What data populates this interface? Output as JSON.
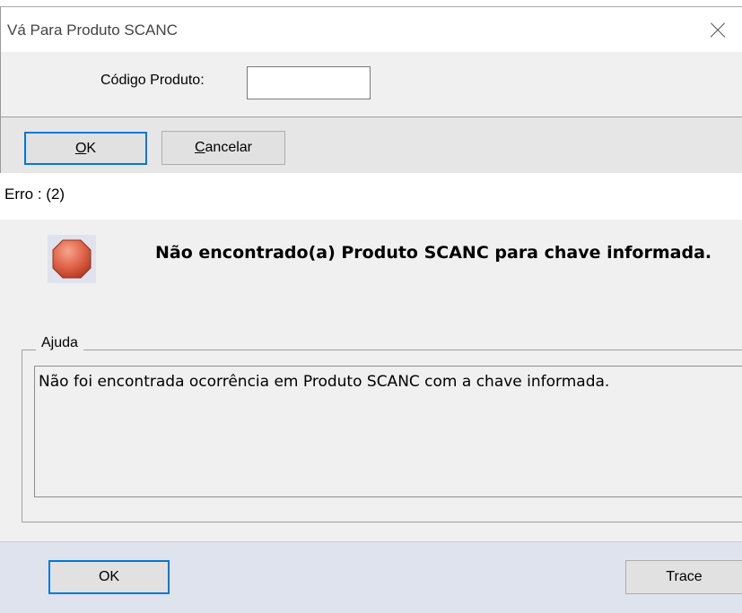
{
  "top_dialog": {
    "title": "Vá Para Produto SCANC",
    "code_label": "Código Produto:",
    "code_value": "",
    "ok_label": "OK",
    "cancel_label": "Cancelar",
    "close_icon": "close-icon"
  },
  "error_dialog": {
    "title": "Erro : (2)",
    "icon": "stop-icon",
    "message": "Não encontrado(a) Produto SCANC para chave informada.",
    "help_legend": "Ajuda",
    "help_text": "Não foi encontrada ocorrência em Produto SCANC com a chave informada.",
    "ok_label": "OK",
    "trace_label": "Trace"
  },
  "colors": {
    "accent": "#0078d7",
    "stop": "#e0654a",
    "button_bar": "#dfe3ee"
  }
}
